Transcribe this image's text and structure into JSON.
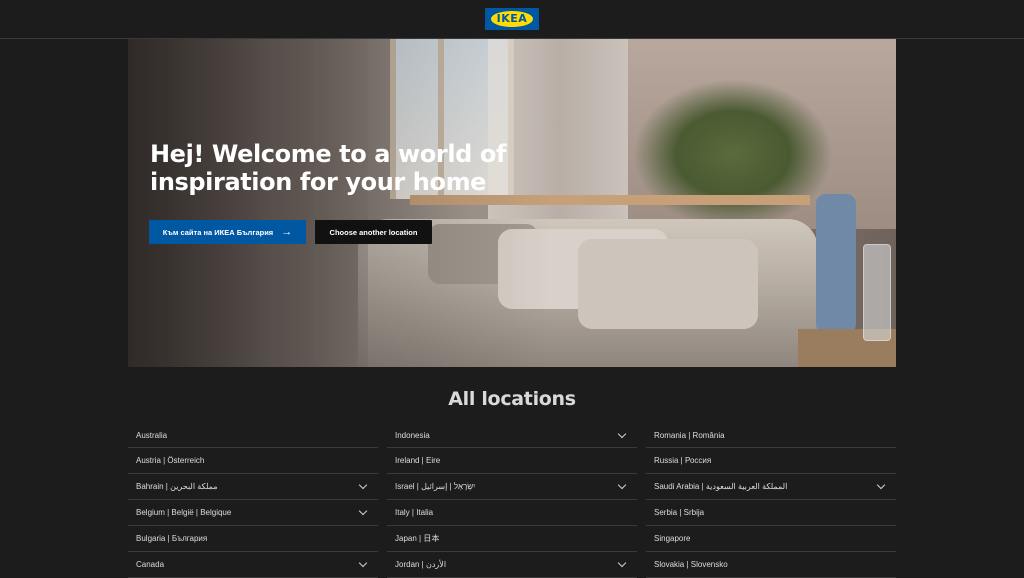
{
  "header": {
    "logo_text": "IKEA"
  },
  "hero": {
    "title": "Hej! Welcome to a world of inspiration for your home",
    "primary_button": "Към сайта на ИКЕА България",
    "secondary_button": "Choose another location"
  },
  "locations": {
    "title": "All locations",
    "columns": [
      [
        {
          "label": "Australia",
          "expandable": false
        },
        {
          "label": "Austria | Österreich",
          "expandable": false
        },
        {
          "label": "Bahrain | مملكة البحرين",
          "expandable": true
        },
        {
          "label": "Belgium | België | Belgique",
          "expandable": true
        },
        {
          "label": "Bulgaria | България",
          "expandable": false
        },
        {
          "label": "Canada",
          "expandable": true
        }
      ],
      [
        {
          "label": "Indonesia",
          "expandable": true
        },
        {
          "label": "Ireland | Eire",
          "expandable": false
        },
        {
          "label": "Israel | יִשְׂרָאֵל | إسرائيل",
          "expandable": true
        },
        {
          "label": "Italy | Italia",
          "expandable": false
        },
        {
          "label": "Japan | 日本",
          "expandable": false
        },
        {
          "label": "Jordan | الأردن",
          "expandable": true
        }
      ],
      [
        {
          "label": "Romania | România",
          "expandable": false
        },
        {
          "label": "Russia | Россия",
          "expandable": false
        },
        {
          "label": "Saudi Arabia | المملكة العربية السعودية",
          "expandable": true
        },
        {
          "label": "Serbia | Srbija",
          "expandable": false
        },
        {
          "label": "Singapore",
          "expandable": false
        },
        {
          "label": "Slovakia | Slovensko",
          "expandable": false
        }
      ]
    ]
  },
  "colors": {
    "background": "#1c1c1c",
    "brand_blue": "#0058a3",
    "brand_yellow": "#ffdb00"
  }
}
